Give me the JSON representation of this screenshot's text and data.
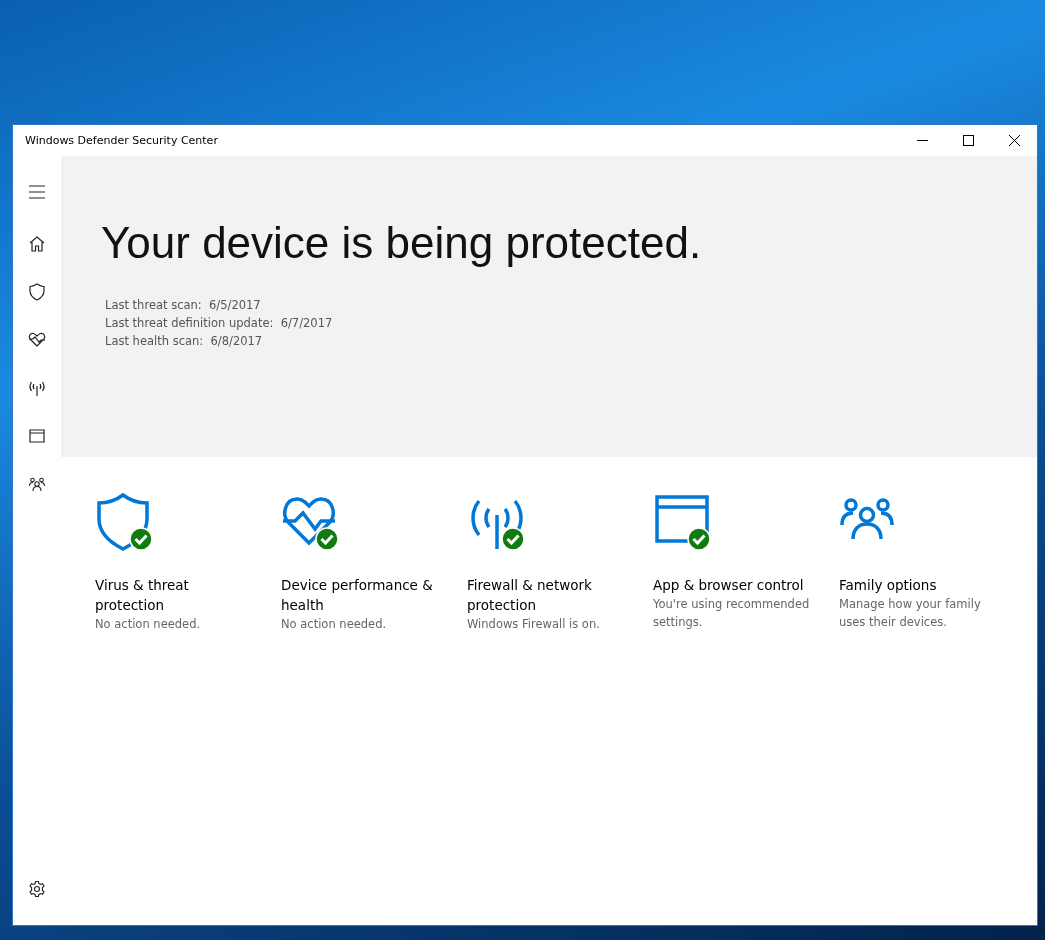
{
  "window": {
    "title": "Windows Defender Security Center"
  },
  "sidebar": {
    "items": [
      {
        "kind": "menu"
      },
      {
        "kind": "home"
      },
      {
        "kind": "shield"
      },
      {
        "kind": "health"
      },
      {
        "kind": "network"
      },
      {
        "kind": "browser"
      },
      {
        "kind": "family"
      }
    ],
    "footer": {
      "kind": "settings"
    }
  },
  "hero": {
    "heading": "Your device is being protected.",
    "details": [
      {
        "label": "Last threat scan:",
        "value": "6/5/2017"
      },
      {
        "label": "Last threat definition update:",
        "value": "6/7/2017"
      },
      {
        "label": "Last health scan:",
        "value": "6/8/2017"
      }
    ]
  },
  "cards": [
    {
      "kind": "shield",
      "title": "Virus & threat protection",
      "status": "No action needed.",
      "ok": true
    },
    {
      "kind": "health",
      "title": "Device performance & health",
      "status": "No action needed.",
      "ok": true
    },
    {
      "kind": "network",
      "title": "Firewall & network protection",
      "status": "Windows Firewall is on.",
      "ok": true
    },
    {
      "kind": "browser",
      "title": "App & browser control",
      "status": "You're using recommended settings.",
      "ok": true
    },
    {
      "kind": "family",
      "title": "Family options",
      "status": "Manage how your family uses their devices.",
      "ok": false
    }
  ]
}
